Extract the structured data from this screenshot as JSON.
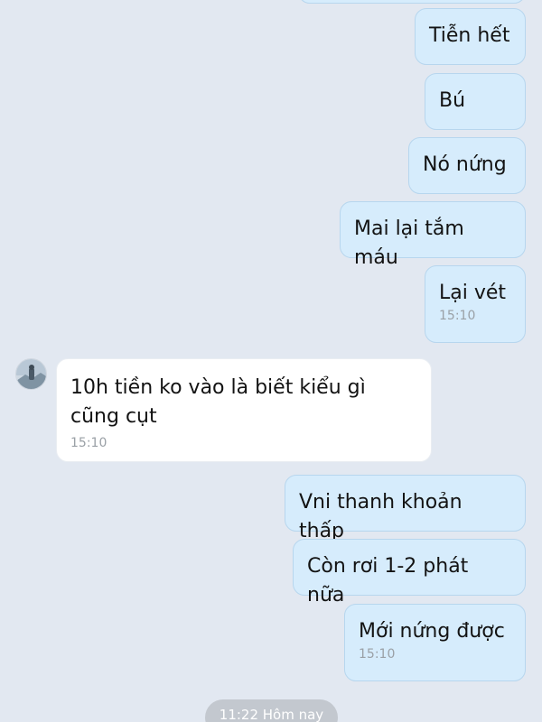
{
  "conversation": {
    "messages": [
      {
        "direction": "out",
        "text": "Tiễn hết"
      },
      {
        "direction": "out",
        "text": "Bú"
      },
      {
        "direction": "out",
        "text": "Nó nứng"
      },
      {
        "direction": "out",
        "text": "Mai lại tắm máu"
      },
      {
        "direction": "out",
        "text": "Lại vét",
        "time": "15:10"
      },
      {
        "direction": "in",
        "text": "10h tiền ko vào là biết kiểu gì cũng cụt",
        "time": "15:10"
      },
      {
        "direction": "out",
        "text": "Vni thanh khoản thấp"
      },
      {
        "direction": "out",
        "text": "Còn rơi 1-2 phát nữa"
      },
      {
        "direction": "out",
        "text": "Mới nứng được",
        "time": "15:10"
      }
    ],
    "time_separator": "11:22 Hôm nay"
  },
  "colors": {
    "background": "#e2e8f1",
    "outgoing_bubble": "#d6ecfc",
    "incoming_bubble": "#ffffff"
  },
  "icons": {
    "contact_avatar": "avatar-photo"
  }
}
